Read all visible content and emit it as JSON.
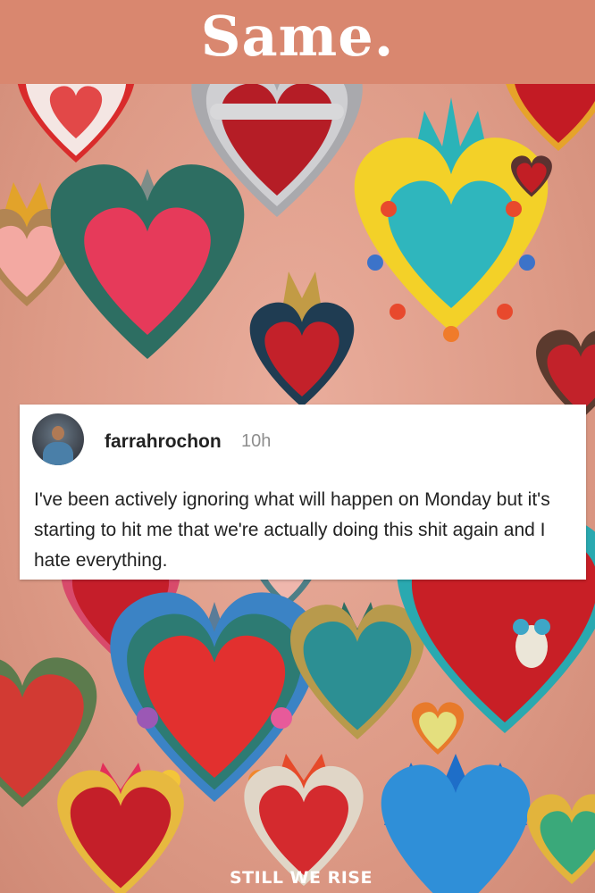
{
  "header": {
    "title": "Same."
  },
  "post": {
    "username": "farrahrochon",
    "time": "10h",
    "text": "I've been actively ignoring what will happen on Monday but it's starting to hit me that we're actually doing this shit again and I hate everything."
  },
  "watermark": "STILL WE RISE",
  "background": {
    "description_icons": [
      "sacred-heart-icon"
    ],
    "colors": {
      "header": "#d9876f",
      "backdrop": "#e2a390"
    }
  }
}
